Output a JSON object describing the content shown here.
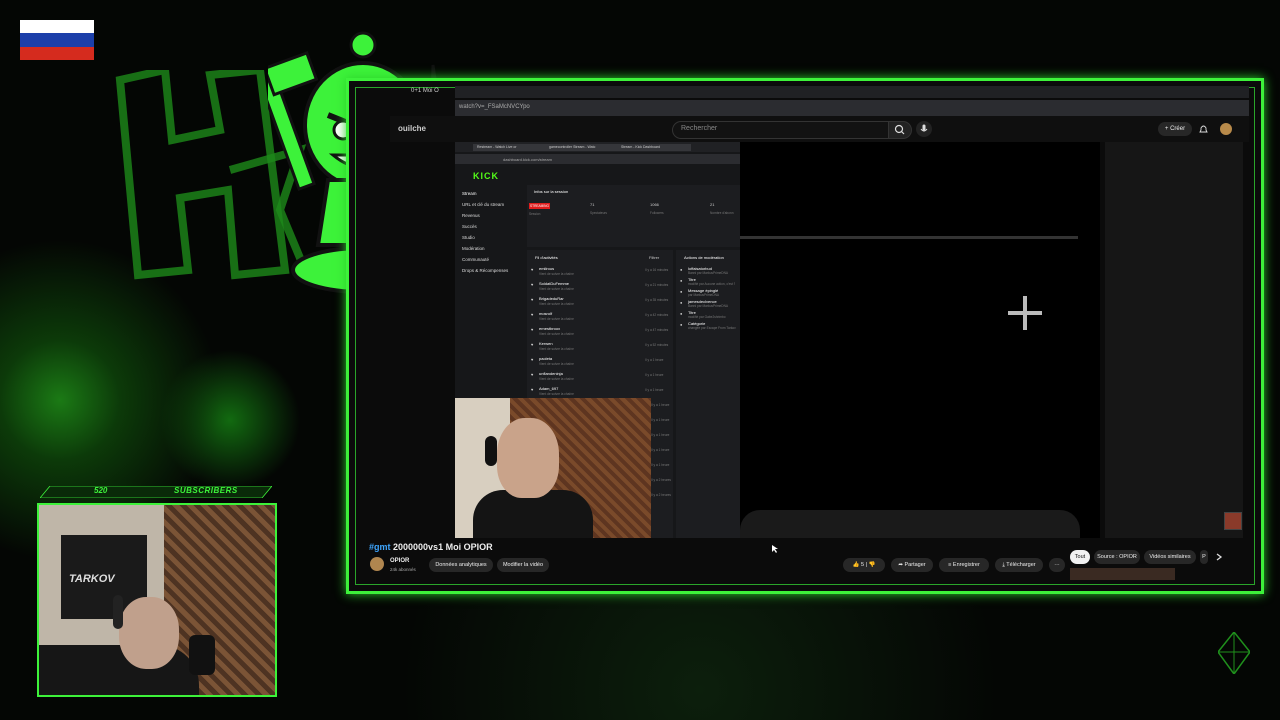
{
  "overlay": {
    "subscriber_count": "520",
    "subscriber_label": "SUBSCRIBERS",
    "colors": {
      "accent": "#3df23a",
      "kick_green": "#53fc18"
    },
    "flag_colors": [
      "#ffffff",
      "#1c3faa",
      "#d52b1e"
    ]
  },
  "browser": {
    "tab_fragment": "0+1 Moi O",
    "address_fragment": "watch?v=_FSaMcNVCYpo",
    "page_fragment": "ouilche"
  },
  "youtube": {
    "search_placeholder": "Rechercher",
    "create_label": "Créer",
    "video_title_tag": "#gmt",
    "video_title": " 2000000vs1 Moi OPIOR",
    "channel_name": "OPIOR",
    "channel_subs": "24k abonnés",
    "analytics_button": "Données analytiques",
    "edit_button": "Modifier la vidéo",
    "likes": "5",
    "share_label": "Partager",
    "save_label": "Enregistrer",
    "download_label": "Télécharger",
    "more_label": "···",
    "filter_chips": [
      "Tout",
      "Source : OPIOR",
      "Vidéos similaires",
      "P"
    ]
  },
  "kick": {
    "tabs": [
      "Restream - Watch Live or",
      "gamecontroller Stream - Watc",
      "Stream - Kick Dashboard"
    ],
    "url": "dashboard.kick.com/stream",
    "logo": "KICK",
    "sidebar": [
      "Stream",
      "URL et clé du stream",
      "Revenus",
      "Succès",
      "Studio",
      "Modération",
      "Communauté",
      "Drops & Récompenses"
    ],
    "session": {
      "title": "Infos sur la session",
      "status": "STREAMING",
      "session_label": "Session",
      "viewers": "71",
      "viewers_label": "Spectateurs",
      "followers": "1066",
      "followers_label": "Followers",
      "subs": "21",
      "subs_label": "Nombre d'abonn"
    },
    "feed_title": "Fil d'activités",
    "feed_filter": "Filtrer",
    "feed": [
      {
        "name": "emilrous",
        "sub": "Vient de suivre la chaîne",
        "time": "Il y a 16 minutes"
      },
      {
        "name": "SoldatDuFemme",
        "sub": "Vient de suivre la chaîne",
        "time": "Il y a 21 minutes"
      },
      {
        "name": "BrigadeduRar",
        "sub": "Vient de suivre la chaîne",
        "time": "Il y a 35 minutes"
      },
      {
        "name": "mosrolf",
        "sub": "Vient de suivre la chaîne",
        "time": "Il y a 42 minutes"
      },
      {
        "name": "ernestbroox",
        "sub": "Vient de suivre la chaîne",
        "time": "Il y a 47 minutes"
      },
      {
        "name": "Kerwen",
        "sub": "Vient de suivre la chaîne",
        "time": "Il y a 52 minutes"
      },
      {
        "name": "paoleta",
        "sub": "Vient de suivre la chaîne",
        "time": "Il y a 1 heure"
      },
      {
        "name": "unflandeninja",
        "sub": "Vient de suivre la chaîne",
        "time": "Il y a 1 heure"
      },
      {
        "name": "Adam_697",
        "sub": "Vient de suivre la chaîne",
        "time": "Il y a 1 heure"
      }
    ],
    "feed_extra_times": [
      "Il y a 1 heure",
      "Il y a 1 heure",
      "Il y a 1 heure",
      "Il y a 1 heure",
      "Il y a 1 heure",
      "Il y a 2 heures",
      "Il y a 2 heures"
    ],
    "mod_title": "Actions de modération",
    "mod": [
      {
        "name": "loffaisatorbud",
        "sub": "Banni par MarkusPrimeDNA"
      },
      {
        "name": "Titre",
        "sub": "modifié par Aucune action, c'est l'"
      },
      {
        "name": "Message épinglé",
        "sub": "par MarkusPrimeDNA"
      },
      {
        "name": "jamesdeclvence",
        "sub": "Banni par MarkusPrimeDNA"
      },
      {
        "name": "Titre",
        "sub": "modifié par Gabe2shrimbo"
      },
      {
        "name": "Catégorie",
        "sub": "changée par Escape From Tarkov"
      }
    ]
  }
}
